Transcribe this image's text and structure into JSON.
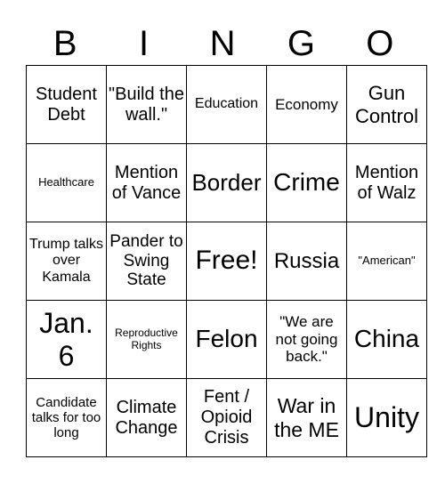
{
  "header": [
    "B",
    "I",
    "N",
    "G",
    "O"
  ],
  "grid": [
    [
      "Student Debt",
      "\"Build the wall.\"",
      "Education",
      "Economy",
      "Gun Control"
    ],
    [
      "Healthcare",
      "Mention of Vance",
      "Border",
      "Crime",
      "Mention of Walz"
    ],
    [
      "Trump talks over Kamala",
      "Pander to Swing State",
      "Free!",
      "Russia",
      "\"American\""
    ],
    [
      "Jan. 6",
      "Reproductive Rights",
      "Felon",
      "\"We are not going back.\"",
      "China"
    ],
    [
      "Candidate talks for too long",
      "Climate Change",
      "Fent / Opioid Crisis",
      "War in the ME",
      "Unity"
    ]
  ]
}
